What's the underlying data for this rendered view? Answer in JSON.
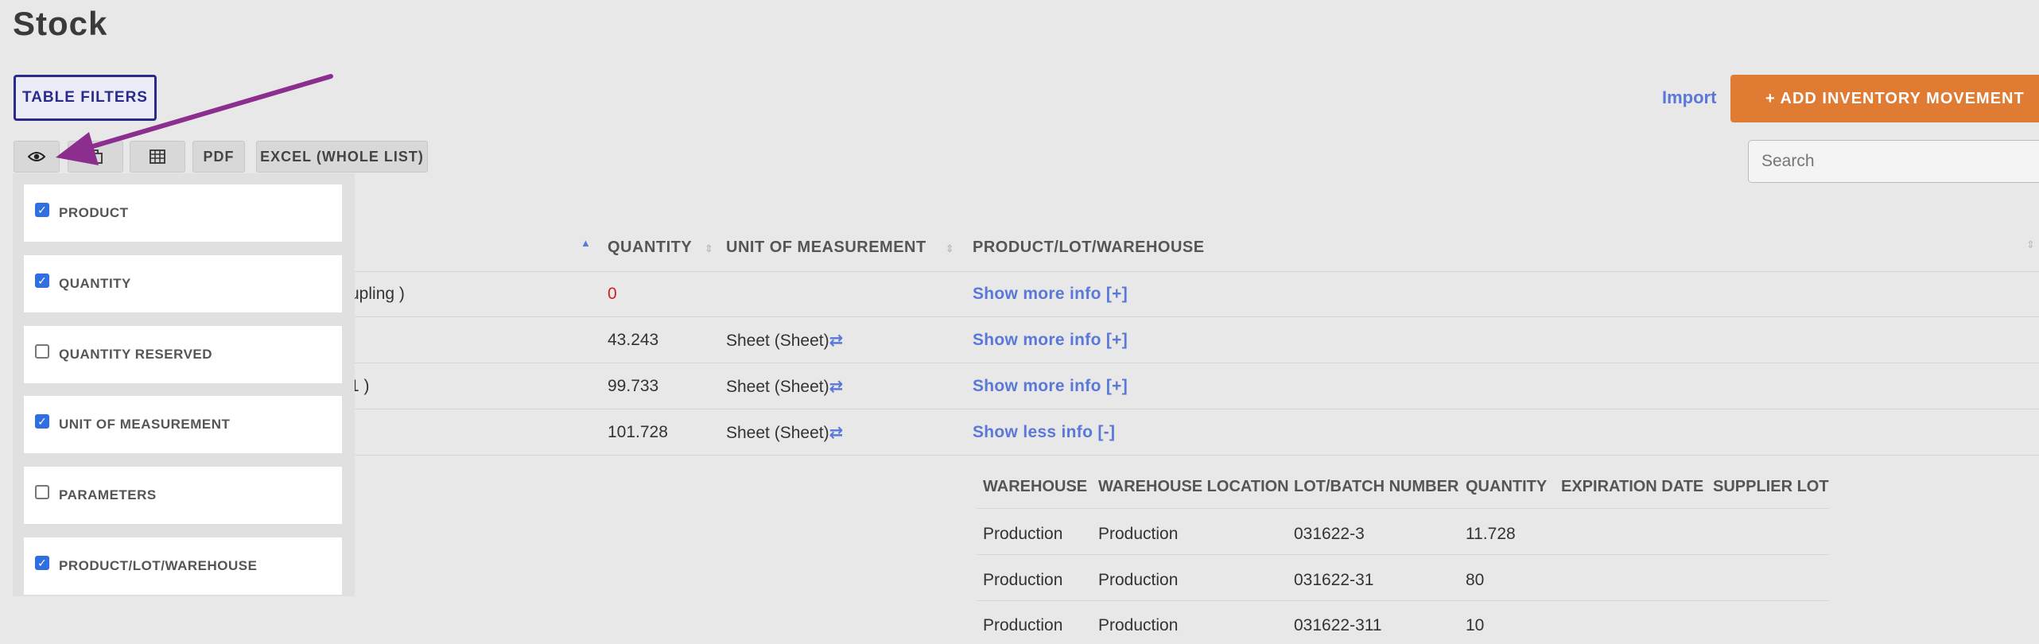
{
  "page": {
    "title": "Stock"
  },
  "toolbar": {
    "table_filters_label": "TABLE FILTERS",
    "import_label": "Import",
    "add_label": "+ ADD INVENTORY MOVEMENT",
    "pdf_label": "PDF",
    "excel_label": "EXCEL (WHOLE LIST)",
    "icons": [
      "eye-icon",
      "copy-icon",
      "table-icon"
    ]
  },
  "search": {
    "placeholder": "Search"
  },
  "table": {
    "headers": [
      "QUANTITY",
      "UNIT OF MEASUREMENT",
      "PRODUCT/LOT/WAREHOUSE"
    ],
    "rows": [
      {
        "product_fragment": "upling )",
        "quantity": "0",
        "unit": "",
        "action": "Show more info [+]"
      },
      {
        "product_fragment": "",
        "quantity": "43.243",
        "unit": "Sheet (Sheet)",
        "action": "Show more info [+]"
      },
      {
        "product_fragment": "1 )",
        "quantity": "99.733",
        "unit": "Sheet (Sheet)",
        "action": "Show more info [+]"
      },
      {
        "product_fragment": "",
        "quantity": "101.728",
        "unit": "Sheet (Sheet)",
        "action": "Show less info [-]"
      }
    ],
    "swap_glyph": "⇄"
  },
  "detail": {
    "headers": [
      "WAREHOUSE",
      "WAREHOUSE LOCATION",
      "LOT/BATCH NUMBER",
      "QUANTITY",
      "EXPIRATION DATE",
      "SUPPLIER LOT"
    ],
    "rows": [
      [
        "Production",
        "Production",
        "031622-3",
        "11.728"
      ],
      [
        "Production",
        "Production",
        "031622-31",
        "80"
      ],
      [
        "Production",
        "Production",
        "031622-311",
        "10"
      ]
    ]
  },
  "column_filter": {
    "options": [
      {
        "label": "PRODUCT",
        "checked": true
      },
      {
        "label": "QUANTITY",
        "checked": true
      },
      {
        "label": "QUANTITY RESERVED",
        "checked": false
      },
      {
        "label": "UNIT OF MEASUREMENT",
        "checked": true
      },
      {
        "label": "PARAMETERS",
        "checked": false
      },
      {
        "label": "PRODUCT/LOT/WAREHOUSE",
        "checked": true
      }
    ]
  },
  "colors": {
    "accent": "#5a78d8",
    "add_button": "#e07b34",
    "arrow": "#8b2e8e",
    "checkbox": "#2f6fe0",
    "zero_qty": "#cc2222"
  }
}
